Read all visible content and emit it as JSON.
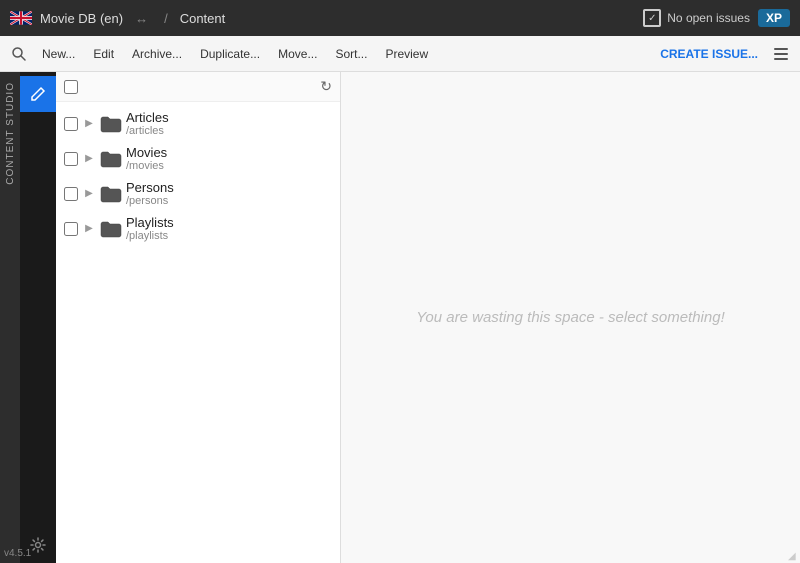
{
  "header": {
    "flag_alt": "UK Flag",
    "app_name": "Movie DB (en)",
    "arrow_icon": "↔",
    "separator": "/",
    "breadcrumb": "Content",
    "issues_label": "No open issues",
    "xp_label": "XP"
  },
  "toolbar": {
    "search_icon": "🔍",
    "new_btn": "New...",
    "edit_btn": "Edit",
    "archive_btn": "Archive...",
    "duplicate_btn": "Duplicate...",
    "move_btn": "Move...",
    "sort_btn": "Sort...",
    "preview_btn": "Preview",
    "create_issue_btn": "CREATE ISSUE...",
    "refresh_icon": "↻"
  },
  "sidebar_left": {
    "label": "CONTENT STUDIO"
  },
  "nav": {
    "icons": [
      {
        "name": "edit-icon",
        "glyph": "✏",
        "active": true
      },
      {
        "name": "settings-icon",
        "glyph": "⚙",
        "active": false
      }
    ]
  },
  "file_tree": {
    "items": [
      {
        "name": "Articles",
        "path": "/articles"
      },
      {
        "name": "Movies",
        "path": "/movies"
      },
      {
        "name": "Persons",
        "path": "/persons"
      },
      {
        "name": "Playlists",
        "path": "/playlists"
      }
    ]
  },
  "content": {
    "placeholder": "You are wasting this space - select something!"
  },
  "footer": {
    "version": "v4.5.1"
  }
}
